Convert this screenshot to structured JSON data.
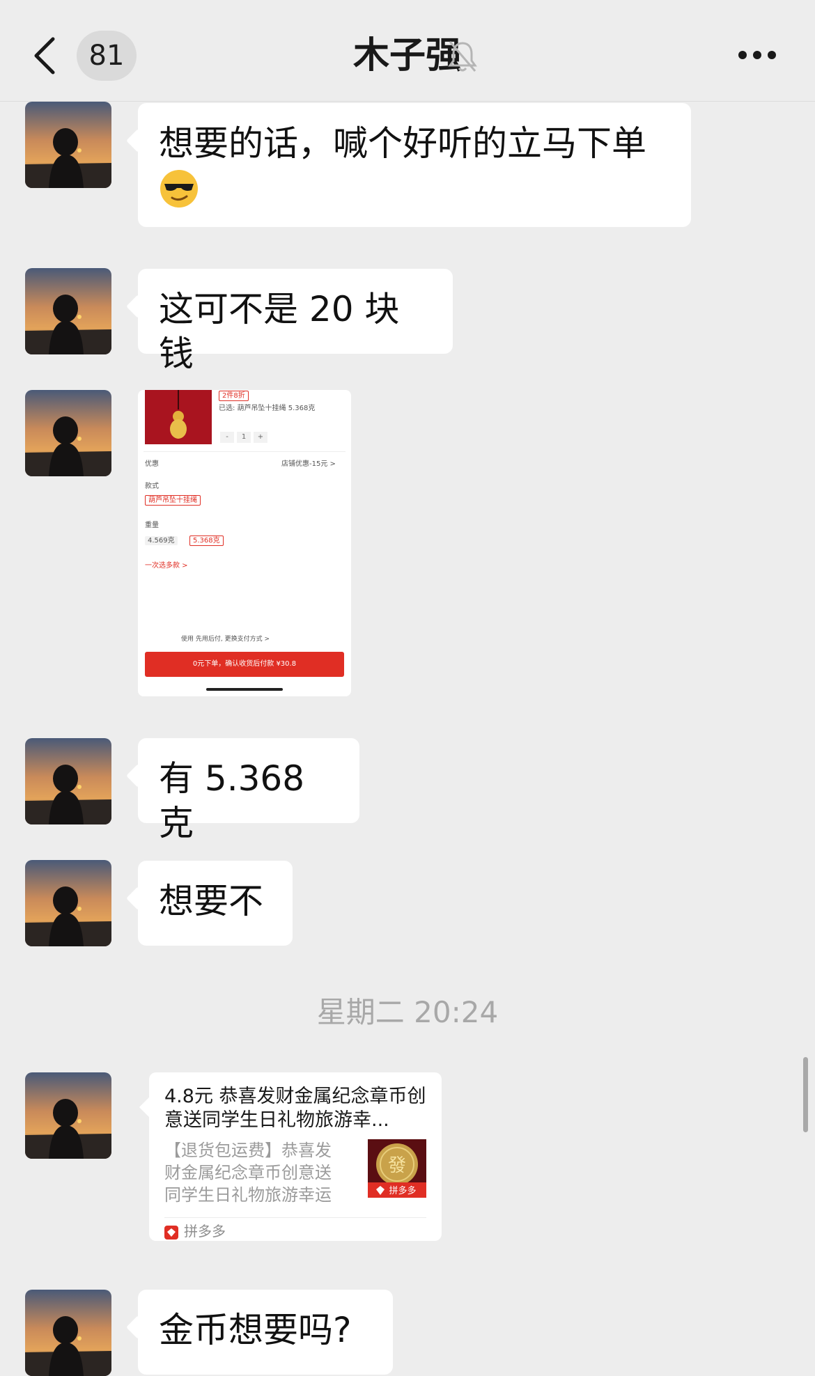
{
  "header": {
    "back_label": "back",
    "unread_count": "81",
    "title": "木子强"
  },
  "messages": [
    {
      "type": "text",
      "text": "想要的话，喊个好听的立马下单",
      "emoji": "smiling-face-with-sunglasses"
    },
    {
      "type": "text",
      "text": "这可不是 20 块钱"
    },
    {
      "type": "image",
      "screenshot": {
        "badge": "2件8折",
        "selected": "已选: 葫芦吊坠十挂绳 5.368克",
        "qty": "1",
        "minus": "-",
        "plus": "+",
        "discount_label": "优惠",
        "discount_value": "店铺优惠-15元 >",
        "style_label": "款式",
        "style_option": "葫芦吊坠十挂绳",
        "weight_label": "重量",
        "weight_option_1": "4.569克",
        "weight_option_2": "5.368克",
        "multi_select": "一次选多款 >",
        "pay_hint": "使用 先用后付, 更换支付方式 >",
        "pay_button": "0元下单，确认收货后付款 ¥30.8"
      }
    },
    {
      "type": "text",
      "text": "有 5.368 克"
    },
    {
      "type": "text",
      "text": "想要不"
    },
    {
      "type": "timestamp",
      "text": "星期二 20:24"
    },
    {
      "type": "link_card",
      "title": "4.8元 恭喜发财金属纪念章币创意送同学生日礼物旅游幸...",
      "description": "【退货包运费】恭喜发财金属纪念章币创意送同学生日礼物旅游幸运收藏...",
      "thumb_label": "拼多多",
      "thumb_char": "發",
      "source": "拼多多"
    },
    {
      "type": "text",
      "text": "金币想要吗?"
    }
  ],
  "colors": {
    "background": "#EDEDED",
    "bubble": "#FFFFFF",
    "pdd_red": "#E02E24",
    "timestamp": "#A8A8A8"
  }
}
